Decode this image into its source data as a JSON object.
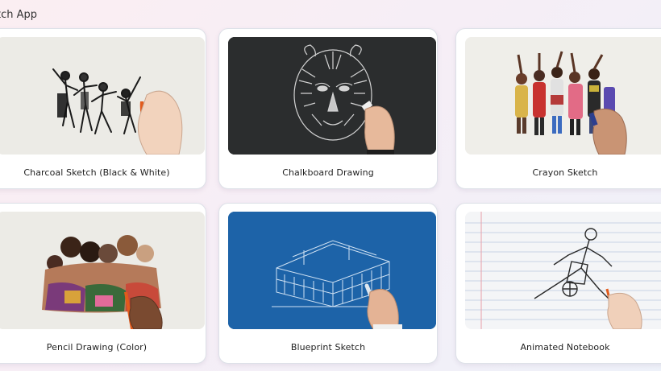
{
  "app": {
    "title": "tch App"
  },
  "styles": [
    {
      "label": "Charcoal Sketch (Black & White)",
      "icon": "charcoal-sketch-thumbnail",
      "bg": "#ecebe6"
    },
    {
      "label": "Chalkboard Drawing",
      "icon": "chalkboard-thumbnail",
      "bg": "#2b2d2e"
    },
    {
      "label": "Crayon Sketch",
      "icon": "crayon-sketch-thumbnail",
      "bg": "#efeee9"
    },
    {
      "label": "Pencil Drawing (Color)",
      "icon": "pencil-color-thumbnail",
      "bg": "#ecebe6"
    },
    {
      "label": "Blueprint Sketch",
      "icon": "blueprint-thumbnail",
      "bg": "#1d63a8"
    },
    {
      "label": "Animated Notebook",
      "icon": "notebook-thumbnail",
      "bg": "#f4f5f7"
    }
  ]
}
